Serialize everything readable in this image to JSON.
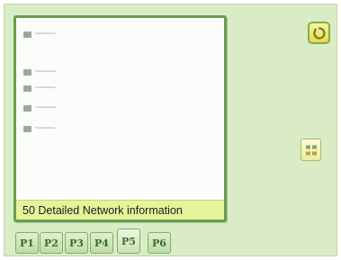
{
  "screen": {
    "entries": [
      {
        "icon": "list-bullet-icon",
        "text": "~~~~~"
      },
      {
        "icon": "list-bullet-icon",
        "text": "~~~~~"
      },
      {
        "icon": "list-bullet-icon",
        "text": "~~~~~"
      },
      {
        "icon": "list-bullet-icon",
        "text": "~~~~~"
      },
      {
        "icon": "list-bullet-icon",
        "text": "~~~~~"
      }
    ],
    "banner_text": "50 Detailed Network information"
  },
  "tabs": [
    {
      "label": "P1"
    },
    {
      "label": "P2"
    },
    {
      "label": "P3"
    },
    {
      "label": "P4"
    },
    {
      "label": "P5"
    },
    {
      "label": "P6"
    }
  ],
  "active_tab": "P5",
  "buttons": {
    "exit_icon": "return-icon",
    "side_icon": "page-select-icon"
  },
  "colors": {
    "screen_background": "#d9ecc5",
    "panel_border": "#6a9c52",
    "banner_background": "#e3f49a",
    "tab_text": "#3b6a33"
  }
}
